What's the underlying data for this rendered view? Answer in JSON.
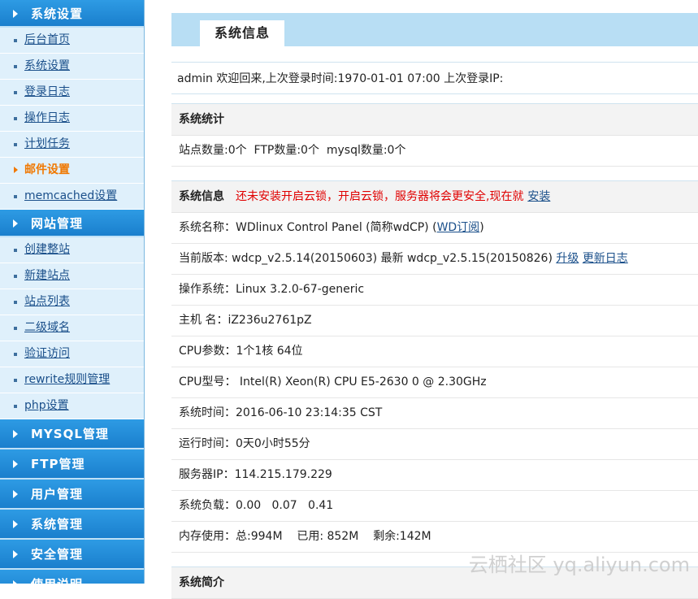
{
  "sidebar": {
    "section_system": "系统设置",
    "system_items": [
      {
        "label": "后台首页"
      },
      {
        "label": "系统设置"
      },
      {
        "label": "登录日志"
      },
      {
        "label": "操作日志"
      },
      {
        "label": "计划任务"
      },
      {
        "label": "邮件设置"
      },
      {
        "label": "memcached设置"
      }
    ],
    "section_site": "网站管理",
    "site_items": [
      {
        "label": "创建整站"
      },
      {
        "label": "新建站点"
      },
      {
        "label": "站点列表"
      },
      {
        "label": "二级域名"
      },
      {
        "label": "验证访问"
      },
      {
        "label": "rewrite规则管理"
      },
      {
        "label": "php设置"
      }
    ],
    "section_mysql": "MYSQL管理",
    "section_ftp": "FTP管理",
    "section_user": "用户管理",
    "section_sys": "系统管理",
    "section_security": "安全管理",
    "section_help": "使用说明"
  },
  "header": {
    "tab_label": "系统信息"
  },
  "welcome": "admin 欢迎回来,上次登录时间:1970-01-01 07:00 上次登录IP:",
  "stats": {
    "title": "系统统计",
    "line": "站点数量:0个  FTP数量:0个  mysql数量:0个"
  },
  "info": {
    "title": "系统信息",
    "warning": "还未安装开启云锁，开启云锁，服务器将会更安全,现在就",
    "install_link": "安装",
    "name_prefix": "系统名称：WDlinux Control Panel (简称wdCP) (",
    "name_link": "WD订阅",
    "name_suffix": ")",
    "version_text": "当前版本: wdcp_v2.5.14(20150603) 最新 wdcp_v2.5.15(20150826)",
    "upgrade_link": "升级",
    "changelog_link": "更新日志",
    "os": "操作系统：Linux 3.2.0-67-generic",
    "host": "主机 名：iZ236u2761pZ",
    "cpu_params": "CPU参数：1个1核 64位",
    "cpu_model": "CPU型号： Intel(R) Xeon(R) CPU E5-2630 0 @ 2.30GHz",
    "sys_time": "系统时间：2016-06-10 23:14:35 CST",
    "uptime": "运行时间：0天0小时55分",
    "server_ip": "服务器IP：114.215.179.229",
    "load": "系统负载：0.00   0.07   0.41",
    "memory": "内存使用：总:994M    已用: 852M    剩余:142M"
  },
  "intro": {
    "title": "系统简介"
  },
  "watermark": "云栖社区 yq.aliyun.com"
}
